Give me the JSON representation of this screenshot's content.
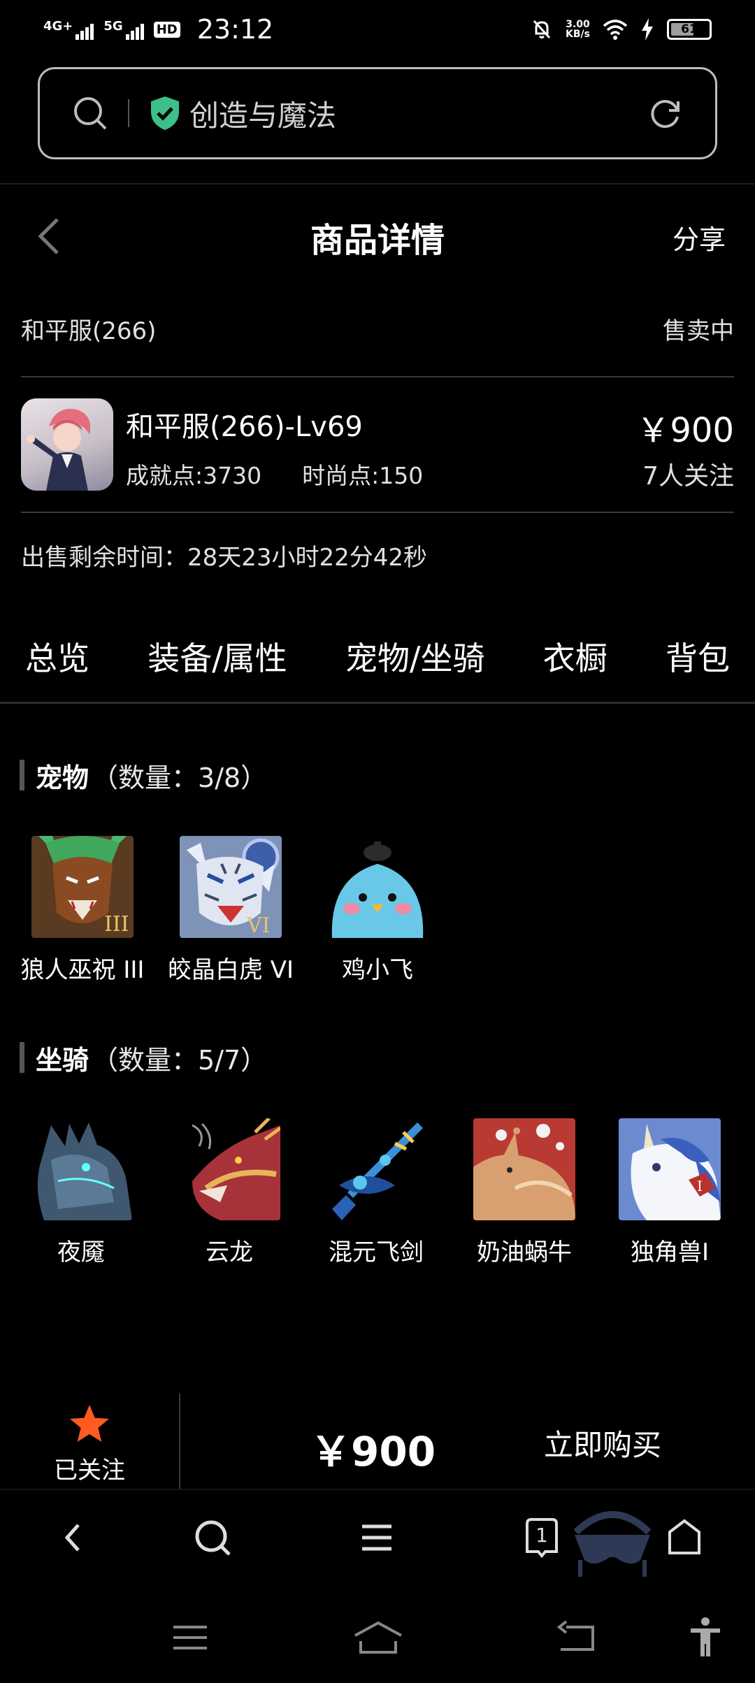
{
  "status_bar": {
    "signal1": "4G+",
    "signal2": "5G",
    "hd": "HD",
    "time": "23:12",
    "speed_value": "3.00",
    "speed_unit": "KB/s",
    "battery": "61"
  },
  "url_bar": {
    "site_title": "创造与魔法"
  },
  "header": {
    "title": "商品详情",
    "share": "分享"
  },
  "server": {
    "name": "和平服(266)",
    "status": "售卖中"
  },
  "product": {
    "name": "和平服(266)-Lv69",
    "achievement": "成就点:3730",
    "fashion": "时尚点:150",
    "price": "￥900",
    "followers": "7人关注"
  },
  "remaining_time": "出售剩余时间：28天23小时22分42秒",
  "tabs": [
    {
      "label": "总览"
    },
    {
      "label": "装备/属性"
    },
    {
      "label": "宠物/坐骑"
    },
    {
      "label": "衣橱"
    },
    {
      "label": "背包"
    }
  ],
  "pets": {
    "title": "宠物",
    "count": "（数量：3/8）",
    "items": [
      {
        "name": "狼人巫祝 III",
        "icon": "werewolf-pet-icon"
      },
      {
        "name": "皎晶白虎 VI",
        "icon": "white-tiger-pet-icon"
      },
      {
        "name": "鸡小飞",
        "icon": "blue-chick-pet-icon"
      }
    ]
  },
  "mounts": {
    "title": "坐骑",
    "count": "（数量：5/7）",
    "items": [
      {
        "name": "夜魇",
        "icon": "nightmare-horse-icon"
      },
      {
        "name": "云龙",
        "icon": "cloud-dragon-icon"
      },
      {
        "name": "混元飞剑",
        "icon": "flying-sword-icon"
      },
      {
        "name": "奶油蜗牛",
        "icon": "cream-snail-icon"
      },
      {
        "name": "独角兽I",
        "icon": "unicorn-icon"
      }
    ]
  },
  "buy_bar": {
    "follow_label": "已关注",
    "price": "￥900",
    "buy_label": "立即购买"
  },
  "browser_bar": {
    "tab_count": "1"
  },
  "colors": {
    "background": "#000000",
    "accent_star": "#ff5a1f",
    "shield_green": "#3dbf8a"
  }
}
